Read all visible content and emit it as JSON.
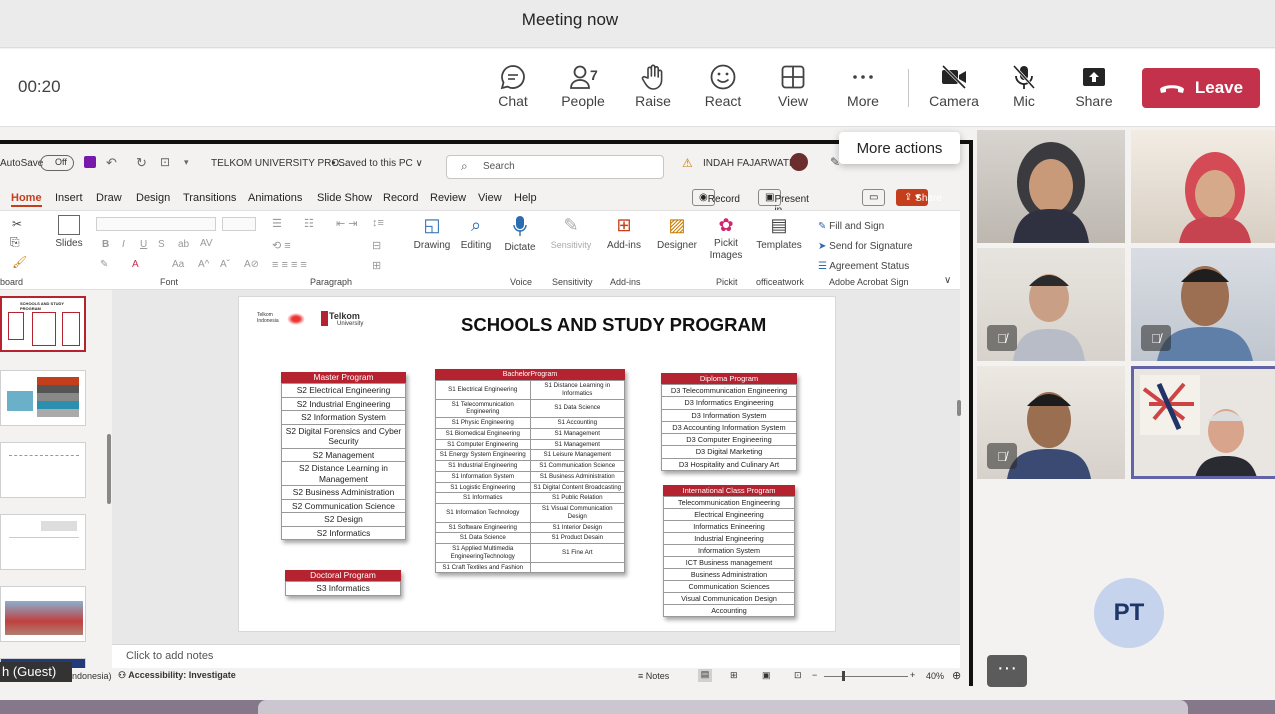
{
  "window": {
    "title": "Meeting now"
  },
  "meeting": {
    "timer": "00:20",
    "toolbar": {
      "chat": "Chat",
      "people": "People",
      "people_count": "7",
      "raise": "Raise",
      "react": "React",
      "view": "View",
      "more": "More",
      "camera": "Camera",
      "mic": "Mic",
      "share": "Share",
      "leave": "Leave"
    },
    "tooltip": "More actions",
    "guest_label": "h (Guest)",
    "avatar_initials": "PT",
    "more_dots": "···"
  },
  "ppt": {
    "autosave": "AutoSave",
    "autosave_state": "Off",
    "file_title": "TELKOM UNIVERSITY PRO...",
    "save_state": "• Saved to this PC ∨",
    "search_placeholder": "Search",
    "user_name": "INDAH FAJARWATI",
    "tabs": [
      "Home",
      "Insert",
      "Draw",
      "Design",
      "Transitions",
      "Animations",
      "Slide Show",
      "Record",
      "Review",
      "View",
      "Help"
    ],
    "record_btn": "Record",
    "present_btn": "Present in Teams",
    "share_btn": "Share",
    "ribbon": {
      "slides": "Slides",
      "drawing": "Drawing",
      "editing": "Editing",
      "dictate": "Dictate",
      "sensitivity": "Sensitivity",
      "addins": "Add-ins",
      "designer": "Designer",
      "pickit": "Pickit Images",
      "templates": "Templates",
      "fill_sign": "Fill and Sign",
      "send_signature": "Send for Signature",
      "agreement": "Agreement Status",
      "g_board": "board",
      "g_font": "Font",
      "g_paragraph": "Paragraph",
      "g_voice": "Voice",
      "g_sensitivity": "Sensitivity",
      "g_addins": "Add-ins",
      "g_pickit": "Pickit",
      "g_officeatwork": "officeatwork",
      "g_acrobat": "Adobe Acrobat Sign"
    },
    "notes_placeholder": "Click to add notes",
    "status": {
      "language": "ndonesia)",
      "accessibility": "Accessibility: Investigate",
      "notes": "Notes",
      "zoom": "40%"
    },
    "slide": {
      "title": "SCHOOLS AND STUDY PROGRAM",
      "logo_telkom": "Telkom",
      "logo_university": "University",
      "logo_indonesia": "Telkom Indonesia",
      "master_header": "Master Program",
      "master": [
        "S2 Electrical Engineering",
        "S2 Industrial Engineering",
        "S2 Information System",
        "S2 Digital Forensics and Cyber Security",
        "S2 Management",
        "S2 Distance Learning in Management",
        "S2 Business Administration",
        "S2 Communication Science",
        "S2 Design",
        "S2  Informatics"
      ],
      "doctoral_header": "Doctoral Program",
      "doctoral": [
        "S3 Informatics"
      ],
      "bachelor_header": "BachelorProgram",
      "bachelor": [
        [
          "S1 Electrical Engineering",
          "S1 Distance Learning in Informatics"
        ],
        [
          "S1 Telecommunication Engineering",
          "S1 Data Science"
        ],
        [
          "S1 Physic Engineering",
          "S1 Accounting"
        ],
        [
          "S1 Biomedical Engineering",
          "S1 Management"
        ],
        [
          "S1 Computer Engineering",
          "S1 Management"
        ],
        [
          "S1 Energy System Engineering",
          "S1 Leisure Management"
        ],
        [
          "S1 Industrial Engineering",
          "S1 Communication Science"
        ],
        [
          "S1 Information System",
          "S1 Business Administration"
        ],
        [
          "S1 Logistic Engineering",
          "S1 Digital Content Broadcasting"
        ],
        [
          "S1 Informatics",
          "S1 Public Relation"
        ],
        [
          "S1 Information Technology",
          "S1 Visual Communication Design"
        ],
        [
          "S1 Software Engineering",
          "S1 Interior Design"
        ],
        [
          "S1 Data Science",
          "S1 Product Desain"
        ],
        [
          "S1 Applied Multimedia EngineeringTechnology",
          "S1 Fine Art"
        ],
        [
          "S1 Craft Textiles and Fashion",
          ""
        ]
      ],
      "diploma_header": "Diploma Program",
      "diploma": [
        "D3 Telecommunication Engineering",
        "D3 Informatics Engineering",
        "D3 Information System",
        "D3 Accounting Information System",
        "D3 Computer Engineering",
        "D3 Digital Marketing",
        "D3 Hospitality and Culinary Art"
      ],
      "intl_header": "International Class Program",
      "intl": [
        "Telecommunication Engineering",
        "Electrical Engineering",
        "Informatics Enineering",
        "Industrial Engineering",
        "Information System",
        "ICT Business management",
        "Business Administration",
        "Communication Sciences",
        "Visual Communication Design",
        "Accounting"
      ]
    }
  },
  "colors": {
    "leave": "#c4314b",
    "accent_red": "#b4232f",
    "ppt_orange": "#c43e1c",
    "avatar_bg": "#c5d3ec"
  }
}
